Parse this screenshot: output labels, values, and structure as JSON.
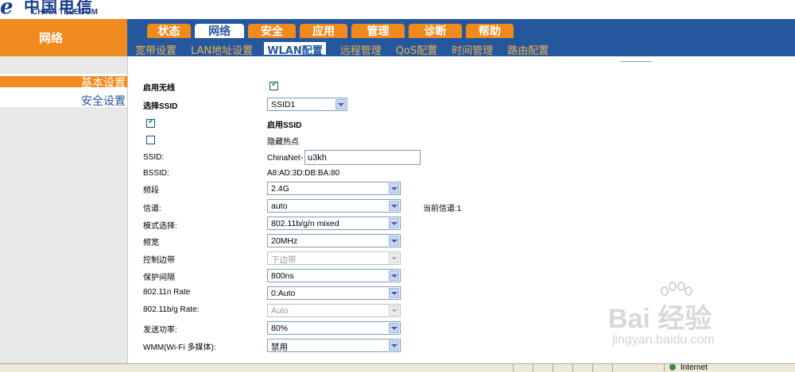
{
  "logo": {
    "mark": "e",
    "name_cn": "中国电信",
    "name_en": "CHINA TELECOM"
  },
  "nav": {
    "section_title": "网络",
    "tabs": [
      "状态",
      "网络",
      "安全",
      "应用",
      "管理",
      "诊断",
      "帮助"
    ],
    "active_tab": "网络",
    "subtabs": [
      "宽带设置",
      "LAN地址设置",
      "WLAN配置",
      "远程管理",
      "QoS配置",
      "时间管理",
      "路由配置"
    ],
    "active_subtab": "WLAN配置"
  },
  "sidebar": {
    "items": [
      "基本设置",
      "安全设置"
    ],
    "active": "基本设置"
  },
  "form": {
    "enable_wireless_label": "启用无线",
    "enable_wireless_checked": true,
    "select_ssid_label": "选择SSID",
    "select_ssid_value": "SSID1",
    "enable_ssid_label": "启用SSID",
    "enable_ssid_checked": true,
    "hide_ap_label": "隐藏热点",
    "hide_ap_checked": false,
    "ssid_label": "SSID:",
    "ssid_prefix": "ChinaNet-",
    "ssid_value": "u3kh",
    "bssid_label": "BSSID:",
    "bssid_value": "A8:AD:3D:DB:BA:80",
    "band_label": "频段",
    "band_value": "2.4G",
    "channel_label": "信道:",
    "channel_value": "auto",
    "current_channel_text": "当前信道:1",
    "mode_label": "模式选择:",
    "mode_value": "802.11b/g/n mixed",
    "bandwidth_label": "频宽",
    "bandwidth_value": "20MHz",
    "sideband_label": "控制边带",
    "sideband_value": "下边带",
    "guard_label": "保护间隔",
    "guard_value": "800ns",
    "n_rate_label": "802.11n Rate",
    "n_rate_value": "0:Auto",
    "bg_rate_label": "802.11b/g Rate:",
    "bg_rate_value": "Auto",
    "tx_power_label": "发送功率:",
    "tx_power_value": "80%",
    "wmm_label": "WMM(Wi-Fi 多媒体):",
    "wmm_value": "禁用"
  },
  "statusbar": {
    "zone_text": "Internet"
  },
  "watermark": {
    "main": "Bai 经验",
    "sub": "jingyan.baidu.com"
  },
  "colors": {
    "orange": "#f08a1e",
    "blue": "#24579e"
  }
}
